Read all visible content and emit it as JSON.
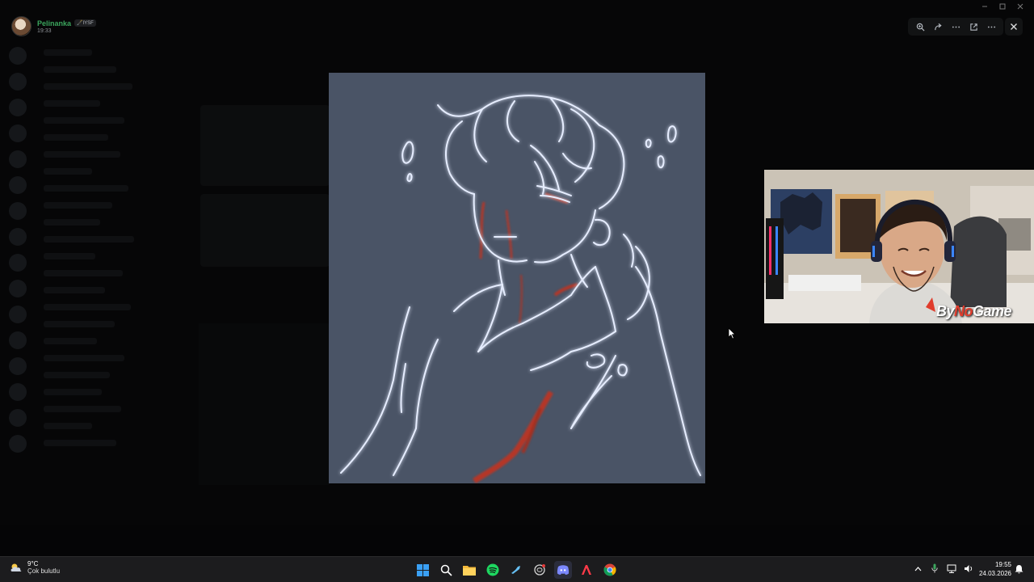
{
  "user": {
    "name": "Pelinanka",
    "tag": "🖋️IYSF",
    "time": "19:33"
  },
  "viewer": {
    "icons": [
      "zoom-icon",
      "share-icon",
      "more-icon",
      "open-external-icon",
      "overflow-icon"
    ],
    "close_icon": "close-icon"
  },
  "webcam": {
    "brand_prefix": "By",
    "brand_mid": "No",
    "brand_suffix": "Game"
  },
  "taskbar": {
    "weather_temp": "9°C",
    "weather_desc": "Çok bulutlu",
    "apps": [
      "windows-start-icon",
      "search-icon",
      "file-explorer-icon",
      "spotify-icon",
      "steam-icon",
      "chatgpt-icon",
      "discord-icon",
      "adobe-icon",
      "chrome-icon"
    ],
    "clock_time": "19:55",
    "clock_date": "24.03.2026"
  },
  "colors": {
    "artwork_bg": "#4a5466",
    "line_glow": "#dfe8ff",
    "blood": "#c8321e",
    "user_name": "#3ba55d"
  }
}
